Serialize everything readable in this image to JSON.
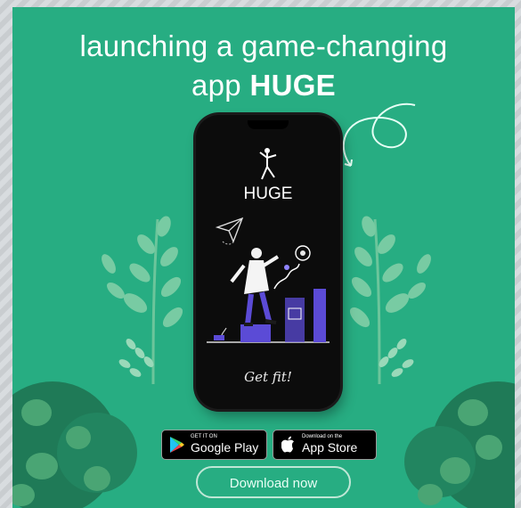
{
  "headline": {
    "line1": "launching a game-changing",
    "line2_prefix": "app ",
    "line2_bold": "HUGE"
  },
  "phone": {
    "app_name": "HUGE",
    "tagline": "Get fit!",
    "illustration": "person-on-blocks-illustration"
  },
  "store_buttons": {
    "google_play": {
      "small": "GET IT ON",
      "big": "Google Play",
      "icon": "google-play-icon"
    },
    "app_store": {
      "small": "Download on the",
      "big": "App Store",
      "icon": "apple-icon"
    }
  },
  "cta": {
    "label": "Download now"
  },
  "colors": {
    "background": "#27ad82",
    "phone": "#0c0c0c",
    "bush_dark": "#1f7a57",
    "bush_light": "#4aa574",
    "accent_purple": "#5b4bd6"
  }
}
